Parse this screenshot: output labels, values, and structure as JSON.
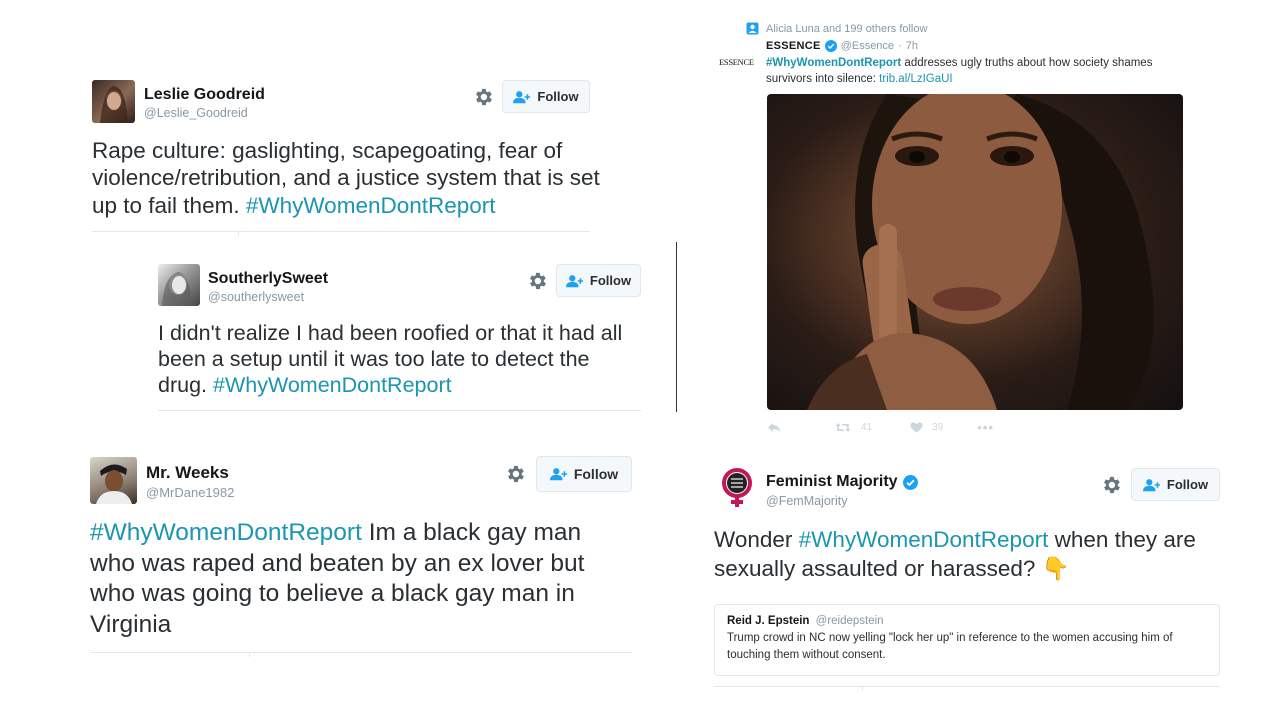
{
  "tweet1": {
    "name": "Leslie Goodreid",
    "handle": "@Leslie_Goodreid",
    "follow_label": "Follow",
    "text": "Rape culture: gaslighting, scapegoating, fear of violence/retribution, and a justice system that is set up to fail them. ",
    "hashtag": "#WhyWomenDontReport"
  },
  "tweet2": {
    "name": "SoutherlySweet",
    "handle": "@southerlysweet",
    "follow_label": "Follow",
    "text": "I didn't realize I had been roofied or that it had all been a setup until it was too late to detect the drug. ",
    "hashtag": "#WhyWomenDontReport"
  },
  "tweet3": {
    "name": "Mr. Weeks",
    "handle": "@MrDane1982",
    "follow_label": "Follow",
    "hashtag": "#WhyWomenDontReport",
    "text": " Im a black gay man who was raped and beaten by an ex lover but who was going to believe a black gay man in Virginia"
  },
  "essence": {
    "context": "Alicia Luna and 199 others follow",
    "logo_text": "ESSENCE",
    "name": "ESSENCE",
    "handle": "@Essence",
    "time": "7h",
    "hashtag": "#WhyWomenDontReport",
    "text": " addresses ugly truths about how society shames survivors into silence: ",
    "link": "trib.al/LzIGaUI",
    "retweets": "41",
    "likes": "39"
  },
  "tweet4": {
    "name": "Feminist Majority",
    "handle": "@FemMajority",
    "follow_label": "Follow",
    "text_a": "Wonder ",
    "hashtag": "#WhyWomenDontReport",
    "text_b": " when they are sexually assaulted or harassed? ",
    "emoji": "👇",
    "quote": {
      "name": "Reid J. Epstein",
      "handle": "@reidepstein",
      "text": "Trump crowd in NC now yelling \"lock her up\" in reference to the women accusing him of touching them without consent."
    }
  },
  "colors": {
    "hashtag": "#1b95b0",
    "verified": "#1da1f2",
    "follow_icon": "#1da1f2",
    "feminist_logo": "#c2185b"
  }
}
